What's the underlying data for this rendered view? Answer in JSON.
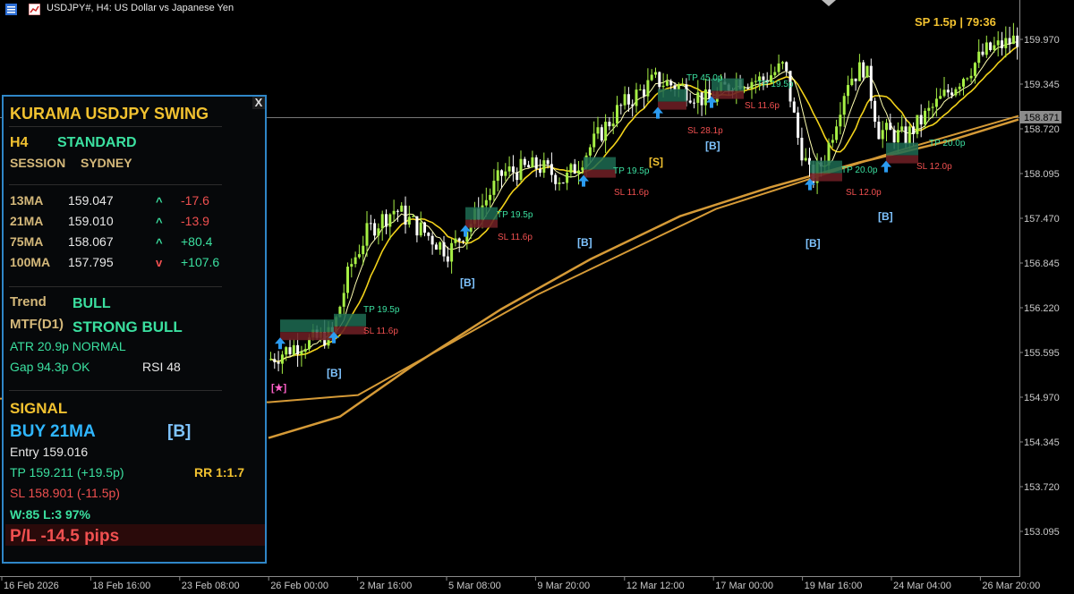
{
  "window": {
    "title": "USDJPY#, H4:  US Dollar vs Japanese Yen",
    "spread_timer": "SP 1.5p  |  79:36"
  },
  "price_axis": {
    "labels": [
      "159.970",
      "159.345",
      "158.720",
      "158.095",
      "157.470",
      "156.845",
      "156.220",
      "155.595",
      "154.970",
      "154.345",
      "153.720",
      "153.095"
    ],
    "current_price": "158.871"
  },
  "time_axis": {
    "labels": [
      "16 Feb 2026",
      "18 Feb 16:00",
      "23 Feb 08:00",
      "26 Feb 00:00",
      "2 Mar 16:00",
      "5 Mar 08:00",
      "9 Mar 20:00",
      "12 Mar 12:00",
      "17 Mar 00:00",
      "19 Mar 16:00",
      "24 Mar 04:00",
      "26 Mar 20:00"
    ]
  },
  "chart_marks": {
    "tp_labels": [
      "TP 19.5p",
      "TP 19.5p",
      "TP 19.5p",
      "TP 45.0p",
      "TP 19.5p",
      "TP 20.0p",
      "TP 20.0p"
    ],
    "sl_labels": [
      "SL 11.6p",
      "SL 11.6p",
      "SL 11.6p",
      "SL 28.1p",
      "SL 11.6p",
      "SL 12.0p",
      "SL 12.0p"
    ],
    "signal_tags": [
      "[B]",
      "[B]",
      "[B]",
      "[S]",
      "[B]",
      "[B]",
      "[B]"
    ],
    "star_tag": "[★]"
  },
  "panel": {
    "title": "KURAMA USDJPY SWING",
    "close": "X",
    "timeframe": "H4",
    "mode": "STANDARD",
    "session_label": "SESSION",
    "session_value": "SYDNEY",
    "ma_rows": [
      {
        "name": "13MA",
        "value": "159.047",
        "arrow": "^",
        "delta": "-17.6"
      },
      {
        "name": "21MA",
        "value": "159.010",
        "arrow": "^",
        "delta": "-13.9"
      },
      {
        "name": "75MA",
        "value": "158.067",
        "arrow": "^",
        "delta": "+80.4"
      },
      {
        "name": "100MA",
        "value": "157.795",
        "arrow": "v",
        "delta": "+107.6"
      }
    ],
    "trend_label": "Trend",
    "trend_value": "BULL",
    "mtf_label": "MTF(D1)",
    "mtf_value": "STRONG BULL",
    "atr": "ATR  20.9p  NORMAL",
    "gap": "Gap 94.3p OK",
    "rsi": "RSI 48",
    "signal_label": "SIGNAL",
    "signal_action": "BUY  21MA",
    "signal_tag": "[B]",
    "entry": "Entry  159.016",
    "tp": "TP  159.211  (+19.5p)",
    "rr": "RR 1:1.7",
    "sl": "SL  158.901  (-11.5p)",
    "stats": "W:85 L:3  97%",
    "pl": "P/L  -14.5 pips"
  },
  "colors": {
    "bull_candle": "#a6ef45",
    "bear_candle": "#ffffff",
    "ma_fast": "#ffffb0",
    "ma_mid": "#f2d21a",
    "ma_slow": "#d59a37",
    "tp_green": "#3be0a0",
    "sl_red": "#f05050",
    "tag_blue": "#7fc4ff",
    "panel_gold": "#f2c230",
    "panel_border": "#2f86c7"
  }
}
